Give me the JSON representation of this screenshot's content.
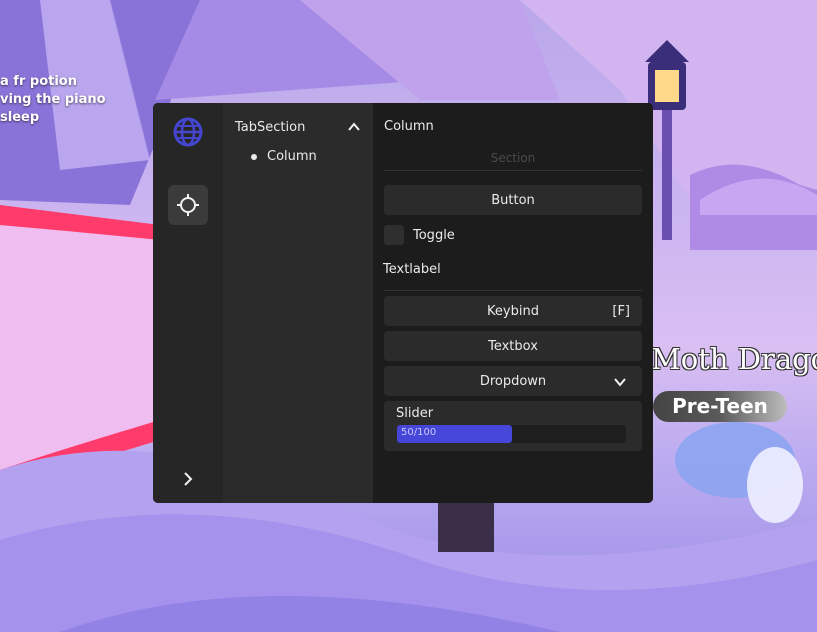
{
  "background": {
    "chat_lines": [
      "a fr potion",
      "ving the piano",
      "sleep"
    ],
    "npc_name": "Moth Drago",
    "npc_badge": "Pre-Teen"
  },
  "window": {
    "rail": {
      "logo_icon": "globe-icon",
      "tab_icon": "crosshair-icon",
      "expand_icon": "chevron-right-icon"
    },
    "tab_section": {
      "title": "TabSection",
      "collapse_icon": "chevron-up-icon",
      "items": [
        {
          "label": "Column"
        }
      ]
    },
    "content": {
      "column_title": "Column",
      "section_label": "Section",
      "button_label": "Button",
      "toggle_label": "Toggle",
      "textlabel": "Textlabel",
      "keybind": {
        "label": "Keybind",
        "key": "[F]"
      },
      "textbox_label": "Textbox",
      "dropdown": {
        "label": "Dropdown",
        "icon": "chevron-down-icon"
      },
      "slider": {
        "label": "Slider",
        "value_text": "50/100",
        "value": 50,
        "max": 100
      }
    },
    "colors": {
      "accent": "#4646d8",
      "panel": "#1c1c1c",
      "rail": "#262626"
    }
  }
}
